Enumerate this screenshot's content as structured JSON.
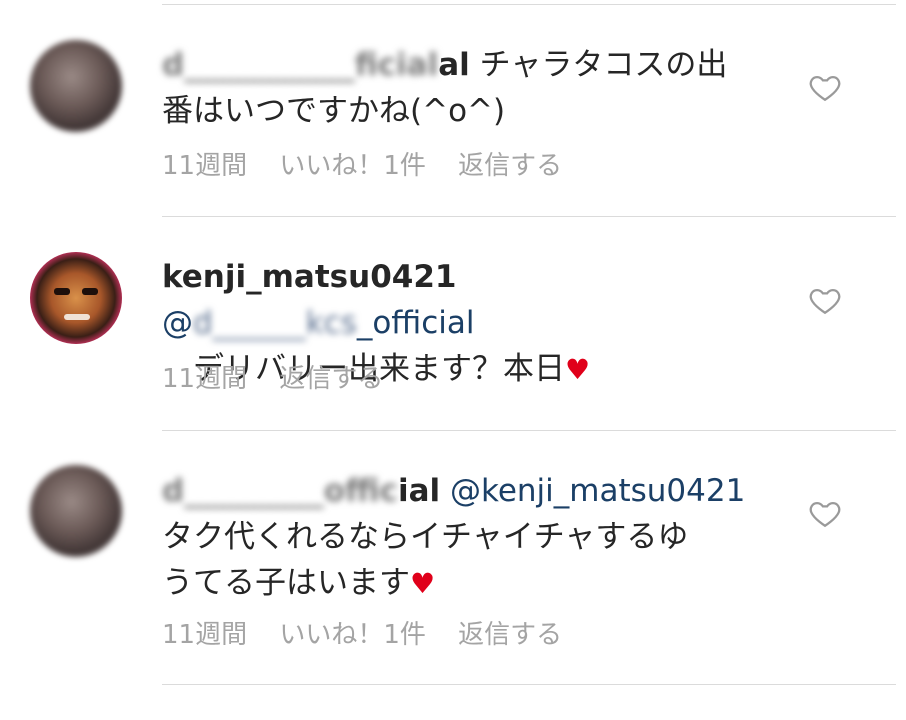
{
  "comments": [
    {
      "username_tail": "al",
      "username_blurred": "d___________ficial",
      "mention": "",
      "body_line1": "チャラタコスの出",
      "body_line2": "番はいつですかね(^o^)",
      "time": "11週間",
      "likes": "いいね！1件",
      "reply": "返信する"
    },
    {
      "username": "kenji_matsu0421",
      "mention_prefix": "@",
      "mention_blurred": "d______kcs",
      "mention_tail": "_official",
      "body": "　デリバリー出来ます？本日",
      "heart": "♥",
      "time": "11週間",
      "reply": "返信する"
    },
    {
      "username_tail": "ial",
      "username_blurred": "d_________offic",
      "mention": "@kenji_matsu0421",
      "body_line1": "タク代くれるならイチャイチャするゆ",
      "body_line2": "うてる子はいます",
      "heart": "♥",
      "time": "11週間",
      "likes": "いいね！1件",
      "reply": "返信する"
    }
  ]
}
